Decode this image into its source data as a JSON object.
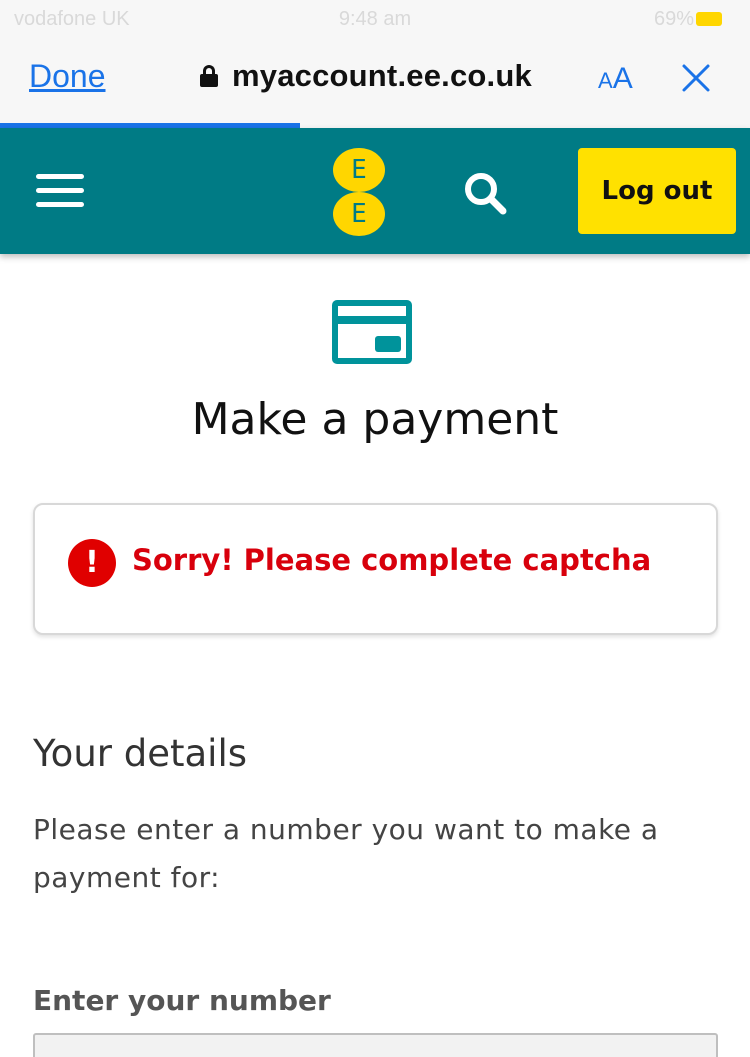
{
  "status_bar": {
    "carrier": "vodafone UK",
    "time": "9:48 am",
    "battery": "69%",
    "battery_color": "#ffd600"
  },
  "browser": {
    "done_label": "Done",
    "url": "myaccount.ee.co.uk",
    "text_size_small": "A",
    "text_size_big": "A",
    "load_progress": 0.4,
    "accent_color": "#1a73e8"
  },
  "header": {
    "brand_color": "#007b85",
    "logo_letters": [
      "E",
      "E"
    ],
    "logout_label": "Log out",
    "logout_color": "#ffe100",
    "icons": [
      "menu-icon",
      "ee-logo",
      "search-icon"
    ]
  },
  "main": {
    "page_icon": "credit-card-icon",
    "title": "Make a payment",
    "error": {
      "icon": "!",
      "message": "Sorry! Please complete captcha",
      "color": "#d8000c"
    },
    "details": {
      "heading": "Your details",
      "description": "Please enter a number you want to make a payment for:",
      "field_label": "Enter your number",
      "field_value": ""
    }
  }
}
